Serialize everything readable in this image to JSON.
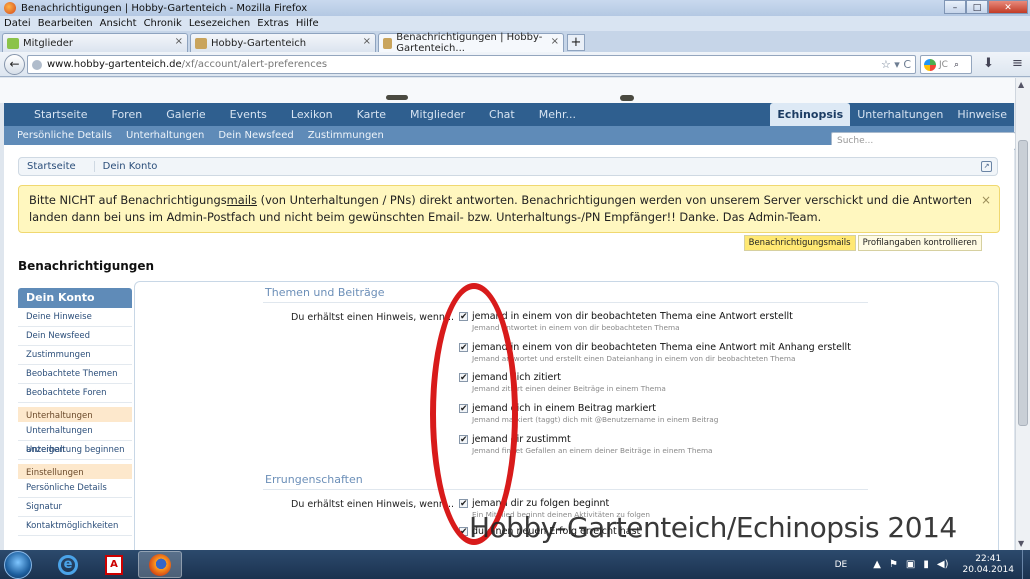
{
  "window": {
    "title": "Benachrichtigungen | Hobby-Gartenteich - Mozilla Firefox",
    "buttons": {
      "minimize": "–",
      "maximize": "□",
      "close": "✕"
    }
  },
  "menu": [
    "Datei",
    "Bearbeiten",
    "Ansicht",
    "Chronik",
    "Lesezeichen",
    "Extras",
    "Hilfe"
  ],
  "tabs": [
    {
      "label": "Mitglieder",
      "close": "×"
    },
    {
      "label": "Hobby-Gartenteich",
      "close": "×"
    },
    {
      "label": "Benachrichtigungen | Hobby-Gartenteich...",
      "close": "×"
    }
  ],
  "newtab": "+",
  "navbar": {
    "back": "←",
    "url_domain": "www.hobby-gartenteich.de",
    "url_path": "/xf/account/alert-preferences",
    "url_tools": "☆ ▾ C",
    "search_placeholder": "JC",
    "search_icon": "⌕",
    "download_icon": "⬇",
    "home_icon": "⌂",
    "menu_icon": "≡"
  },
  "site": {
    "nav": [
      "Startseite",
      "Foren",
      "Galerie",
      "Events",
      "Lexikon",
      "Karte",
      "Mitglieder",
      "Chat",
      "Mehr..."
    ],
    "nav_right": [
      "Echinopsis",
      "Unterhaltungen",
      "Hinweise"
    ],
    "subnav": [
      "Persönliche Details",
      "Unterhaltungen",
      "Dein Newsfeed",
      "Zustimmungen"
    ],
    "search_placeholder": "Suche..."
  },
  "breadcrumb": [
    "Startseite",
    "Dein Konto"
  ],
  "breadcrumb_icon": "↗",
  "notice": {
    "text_before": "Bitte NICHT auf Benachrichtigungs",
    "text_underlined": "mails",
    "text_after": " (von Unterhaltungen / PNs) direkt antworten. Benachrichtigungen werden von unserem Server verschickt und die Antworten landen dann bei uns im Admin-Postfach und nicht beim gewünschten Email- bzw. Unterhaltungs-/PN Empfänger!! Danke. Das Admin-Team.",
    "close": "×"
  },
  "notice_tabs": [
    "Benachrichtigungsmails",
    "Profilangaben kontrollieren"
  ],
  "page_title": "Benachrichtigungen",
  "sidebar": {
    "heading": "Dein Konto",
    "group1": [
      "Deine Hinweise",
      "Dein Newsfeed",
      "Zustimmungen",
      "Beobachtete Themen",
      "Beobachtete Foren"
    ],
    "section2": "Unterhaltungen",
    "group2": [
      "Unterhaltungen anzeigen",
      "Unterhaltung beginnen"
    ],
    "section3": "Einstellungen",
    "group3": [
      "Persönliche Details",
      "Signatur",
      "Kontaktmöglichkeiten"
    ]
  },
  "form": {
    "section1": "Themen und Beiträge",
    "section2": "Errungenschaften",
    "row_label": "Du erhältst einen Hinweis, wenn...",
    "check": "✔",
    "options1": [
      {
        "label": "jemand in einem von dir beobachteten Thema eine Antwort erstellt",
        "hint": "Jemand antwortet in einem von dir beobachteten Thema"
      },
      {
        "label": "jemand in einem von dir beobachteten Thema eine Antwort mit Anhang erstellt",
        "hint": "Jemand antwortet und erstellt einen Dateianhang in einem von dir beobachteten Thema"
      },
      {
        "label": "jemand dich zitiert",
        "hint": "Jemand zitiert einen deiner Beiträge in einem Thema"
      },
      {
        "label": "jemand dich in einem Beitrag markiert",
        "hint": "Jemand markiert (taggt) dich mit @Benutzername in einem Beitrag"
      },
      {
        "label": "jemand dir zustimmt",
        "hint": "Jemand findet Gefallen an einem deiner Beiträge in einem Thema"
      }
    ],
    "options2": [
      {
        "label": "jemand dir zu folgen beginnt",
        "hint": "Ein Mitglied beginnt deinen Aktivitäten zu folgen"
      },
      {
        "label": "du einen neuen Erfolg erreicht hast",
        "hint": ""
      }
    ]
  },
  "watermark": "Hobby-Gartenteich/Echinopsis 2014",
  "taskbar": {
    "ie_glyph": "e",
    "acrobat_glyph": "A",
    "lang": "DE",
    "tray_icons": [
      "▲",
      "⚑",
      "▣",
      "▮",
      "◀)"
    ],
    "time": "22:41",
    "date": "20.04.2014"
  },
  "colors": {
    "nav": "#2f5f8f",
    "subnav": "#5f8bb8",
    "notice": "#fff7bf",
    "ellipse": "#d81b1b"
  }
}
